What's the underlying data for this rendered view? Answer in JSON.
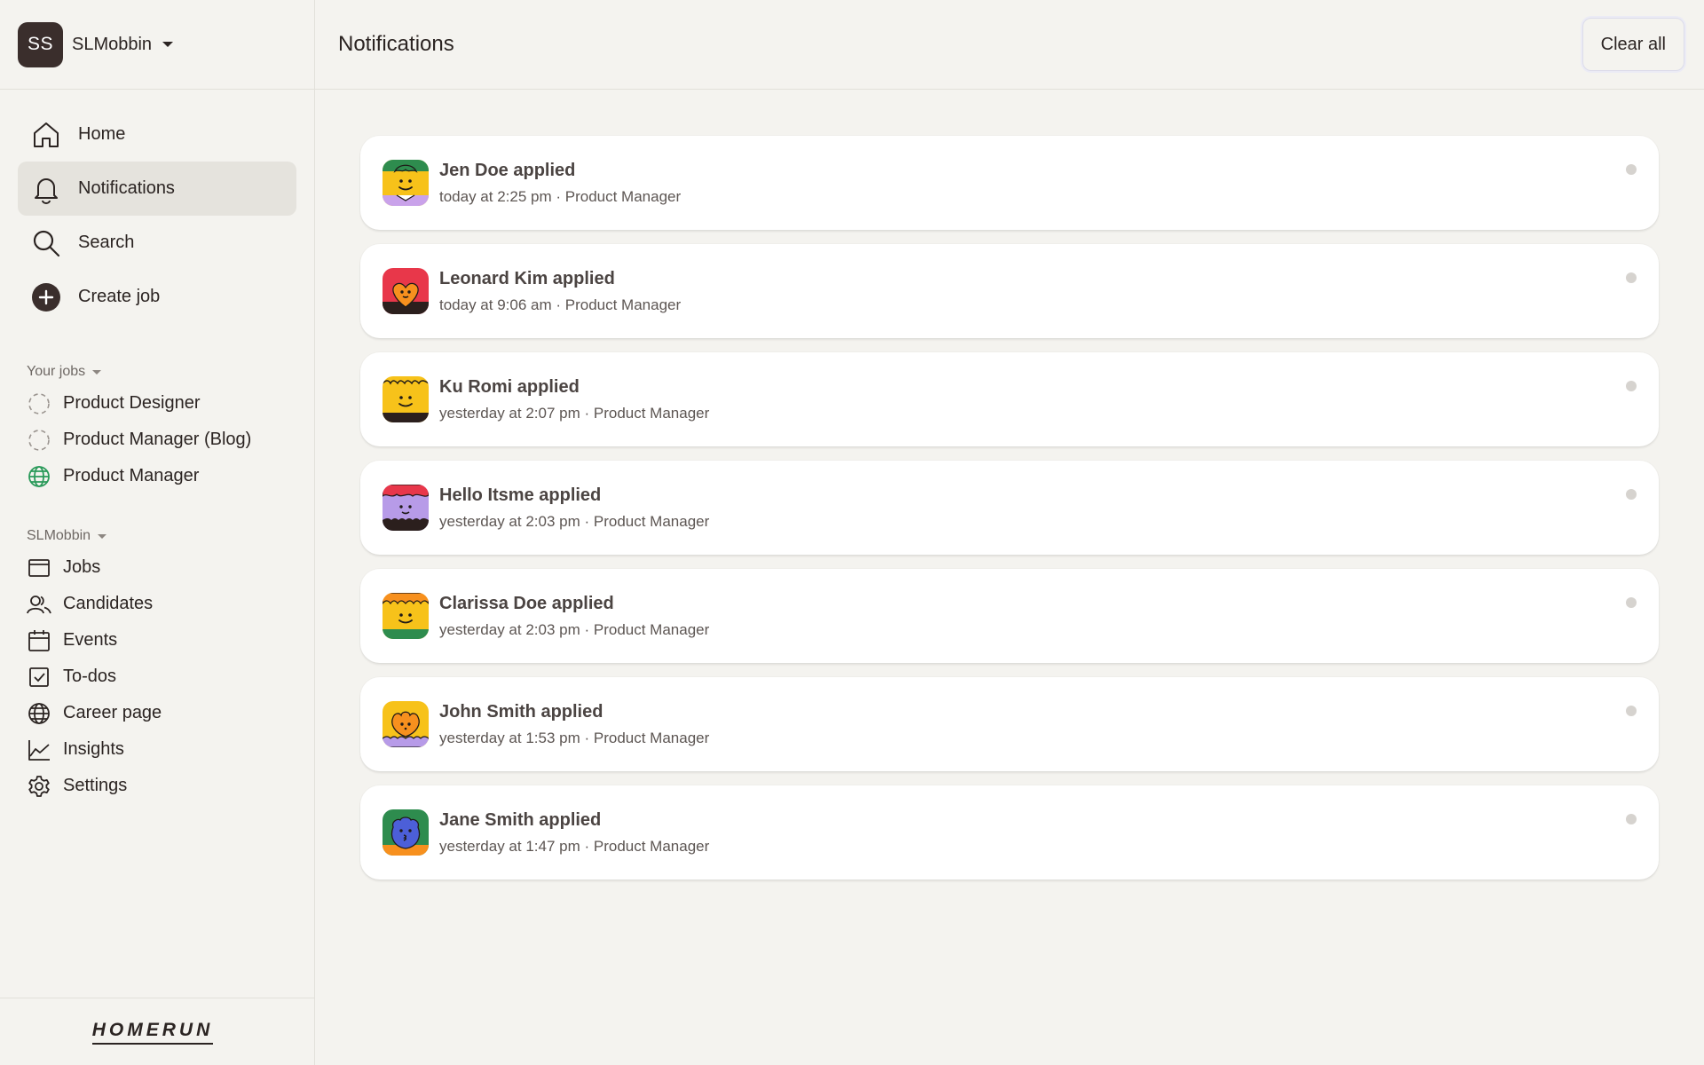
{
  "workspace": {
    "initials": "SS",
    "name": "SLMobbin"
  },
  "main_nav": [
    {
      "label": "Home",
      "icon": "home-icon",
      "active": false
    },
    {
      "label": "Notifications",
      "icon": "bell-icon",
      "active": true
    },
    {
      "label": "Search",
      "icon": "search-icon",
      "active": false
    },
    {
      "label": "Create job",
      "icon": "plus-circle-icon",
      "active": false
    }
  ],
  "your_jobs": {
    "title": "Your jobs",
    "items": [
      {
        "label": "Product Designer",
        "icon": "draft-dashed-circle-icon"
      },
      {
        "label": "Product Manager (Blog)",
        "icon": "draft-dashed-circle-icon"
      },
      {
        "label": "Product Manager",
        "icon": "published-globe-icon"
      }
    ]
  },
  "company": {
    "title": "SLMobbin",
    "items": [
      {
        "label": "Jobs",
        "icon": "window-icon"
      },
      {
        "label": "Candidates",
        "icon": "people-icon"
      },
      {
        "label": "Events",
        "icon": "calendar-icon"
      },
      {
        "label": "To-dos",
        "icon": "checkbox-icon"
      },
      {
        "label": "Career page",
        "icon": "globe-icon"
      },
      {
        "label": "Insights",
        "icon": "line-chart-icon"
      },
      {
        "label": "Settings",
        "icon": "gear-icon"
      }
    ]
  },
  "brand": {
    "logo_text": "HOMERUN"
  },
  "header": {
    "title": "Notifications",
    "clear_label": "Clear all"
  },
  "notifications": [
    {
      "title": "Jen Doe applied",
      "meta": "today at 2:25 pm · Product Manager",
      "avatar": "avatar-jen-doe",
      "unread": true
    },
    {
      "title": "Leonard Kim applied",
      "meta": "today at 9:06 am · Product Manager",
      "avatar": "avatar-leonard-kim",
      "unread": true
    },
    {
      "title": "Ku Romi applied",
      "meta": "yesterday at 2:07 pm · Product Manager",
      "avatar": "avatar-ku-romi",
      "unread": true
    },
    {
      "title": "Hello Itsme applied",
      "meta": "yesterday at 2:03 pm · Product Manager",
      "avatar": "avatar-hello-itsme",
      "unread": true
    },
    {
      "title": "Clarissa Doe applied",
      "meta": "yesterday at 2:03 pm · Product Manager",
      "avatar": "avatar-clarissa-doe",
      "unread": true
    },
    {
      "title": "John Smith applied",
      "meta": "yesterday at 1:53 pm · Product Manager",
      "avatar": "avatar-john-smith",
      "unread": true
    },
    {
      "title": "Jane Smith applied",
      "meta": "yesterday at 1:47 pm · Product Manager",
      "avatar": "avatar-jane-smith",
      "unread": true
    }
  ],
  "colors": {
    "background": "#f4f3ef",
    "card": "#ffffff",
    "active_nav": "#e5e3dd",
    "text": "#2b2422",
    "unread_dot": "#d6d3cf",
    "published_green": "#2a9a5a"
  }
}
